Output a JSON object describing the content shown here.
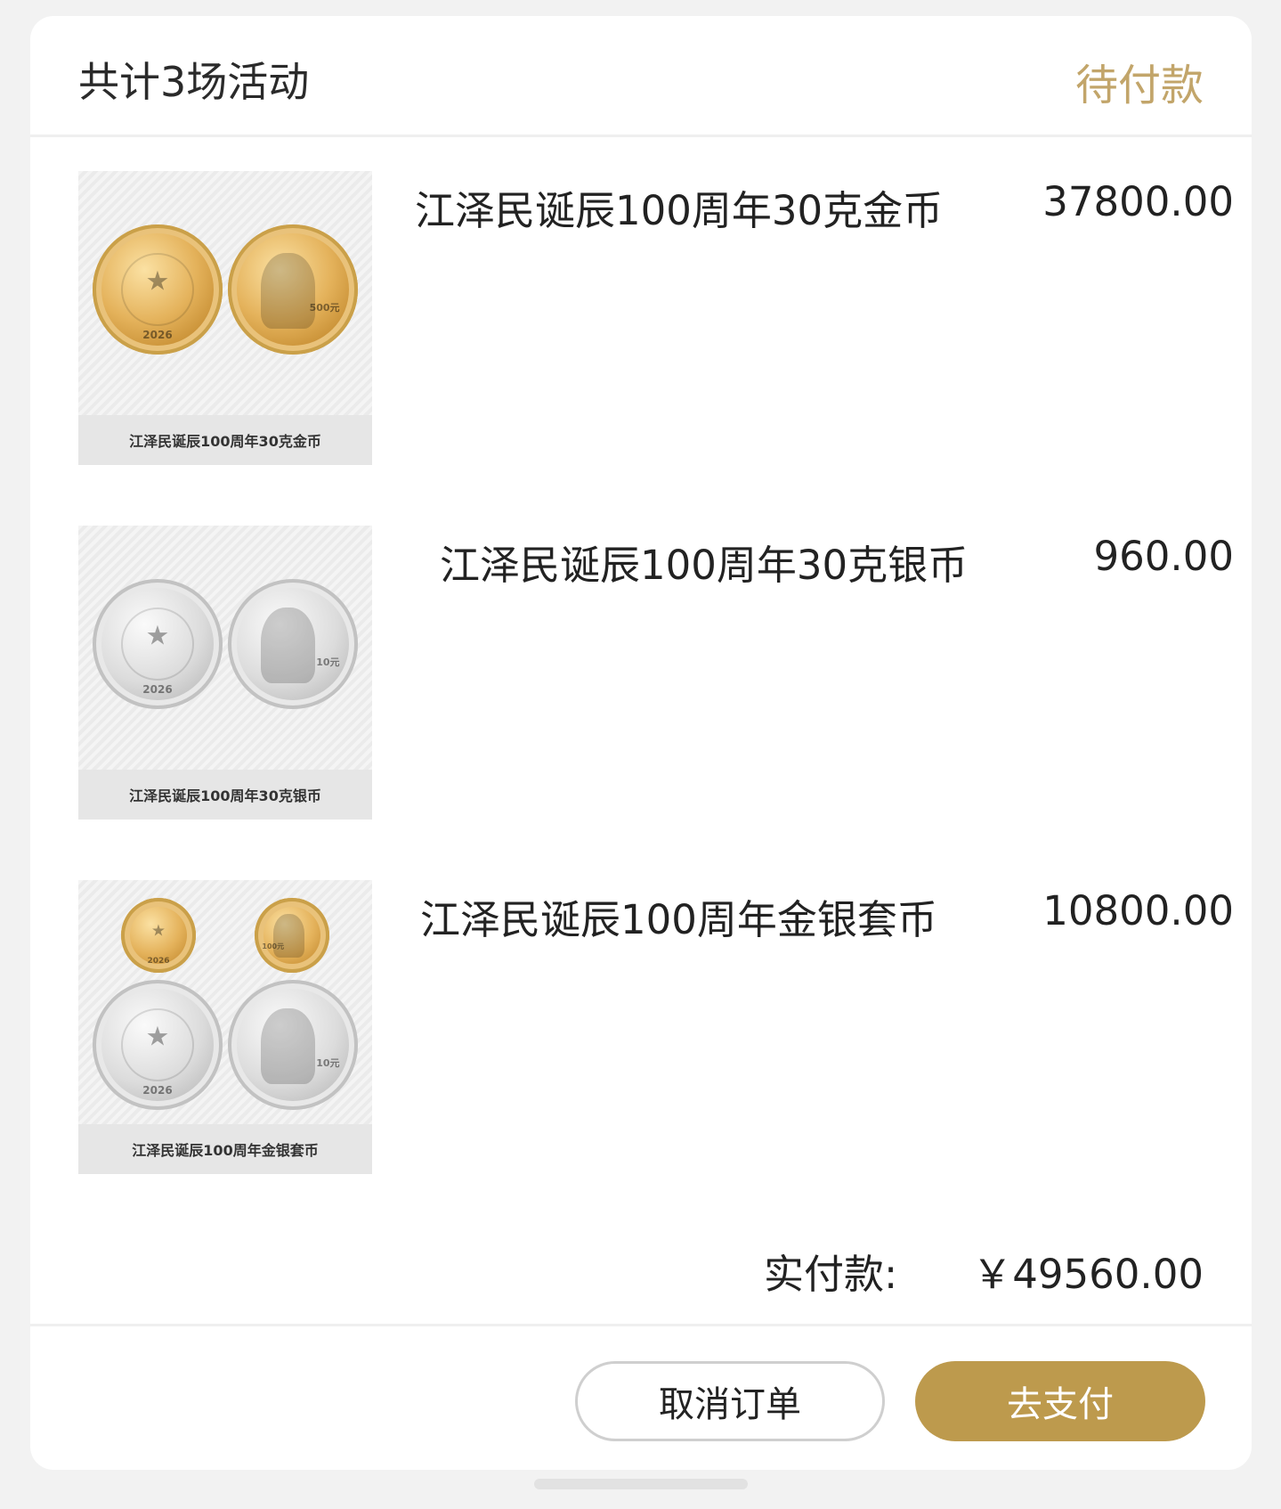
{
  "header": {
    "title": "共计3场活动",
    "status": "待付款"
  },
  "items": [
    {
      "name": "江泽民诞辰100周年30克金币",
      "price": "37800.00",
      "image_caption": "江泽民诞辰100周年30克金币",
      "coins": [
        {
          "metal": "gold",
          "side": "emblem",
          "year": "2026"
        },
        {
          "metal": "gold",
          "side": "portrait",
          "denomination": "500元"
        }
      ]
    },
    {
      "name": "江泽民诞辰100周年30克银币",
      "price": "960.00",
      "image_caption": "江泽民诞辰100周年30克银币",
      "coins": [
        {
          "metal": "silver",
          "side": "emblem",
          "year": "2026"
        },
        {
          "metal": "silver",
          "side": "portrait",
          "denomination": "10元"
        }
      ]
    },
    {
      "name": "江泽民诞辰100周年金银套币",
      "price": "10800.00",
      "image_caption": "江泽民诞辰100周年金银套币",
      "coins": [
        {
          "metal": "gold",
          "side": "emblem",
          "year": "2026"
        },
        {
          "metal": "gold",
          "side": "portrait",
          "denomination": "100元"
        },
        {
          "metal": "silver",
          "side": "emblem",
          "year": "2026"
        },
        {
          "metal": "silver",
          "side": "portrait",
          "denomination": "10元"
        }
      ]
    }
  ],
  "summary": {
    "label": "实付款:",
    "amount": "￥49560.00"
  },
  "actions": {
    "cancel_label": "取消订单",
    "pay_label": "去支付"
  },
  "colors": {
    "accent_gold": "#bd9a4d",
    "status_text": "#c2a56a"
  }
}
